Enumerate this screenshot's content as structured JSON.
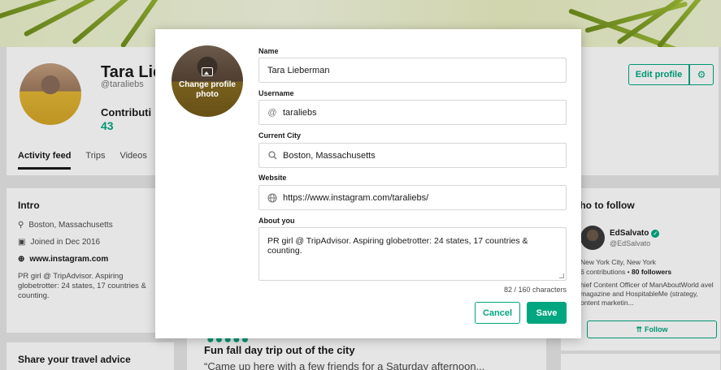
{
  "profile": {
    "name": "Tara Lieberman",
    "name_visible": "Tara Liel",
    "handle": "@taraliebs",
    "contributions_label": "Contributi",
    "contributions_count": "43"
  },
  "tabs": [
    "Activity feed",
    "Trips",
    "Videos"
  ],
  "header_actions": {
    "edit_label": "Edit profile",
    "settings_icon": "gear-icon"
  },
  "intro": {
    "title": "Intro",
    "location": "Boston, Massachusetts",
    "joined": "Joined in Dec 2016",
    "website": "www.instagram.com",
    "bio": "PR girl @ TripAdvisor. Aspiring globetrotter: 24 states, 17 countries & counting."
  },
  "share": {
    "title": "Share your travel advice"
  },
  "feed": {
    "rating": "●●●●●",
    "title": "Fun fall day trip out of the city",
    "quote": "“Came up here with a few friends for a Saturday afternoon..."
  },
  "who_to_follow": {
    "title": "Who to follow",
    "title_visible": "/ho to follow",
    "user": {
      "name": "EdSalvato",
      "handle": "@EdSalvato",
      "location": "New York City, New York",
      "contributions": "6 contributions",
      "followers": "80 followers",
      "bio": "hief Content Officer of ManAboutWorld avel magazine and HospitableMe (strategy, ontent marketin..."
    },
    "follow_label": "Follow"
  },
  "modal": {
    "avatar_label": "Change profile photo",
    "name_label": "Name",
    "name_value": "Tara Lieberman",
    "username_label": "Username",
    "username_prefix": "@",
    "username_value": "taraliebs",
    "city_label": "Current City",
    "city_value": "Boston, Massachusetts",
    "website_label": "Website",
    "website_value": "https://www.instagram.com/taraliebs/",
    "about_label": "About you",
    "about_value": "PR girl @ TripAdvisor. Aspiring globetrotter: 24 states, 17 countries & counting.",
    "counter": "82 / 160 characters",
    "cancel_label": "Cancel",
    "save_label": "Save"
  },
  "colors": {
    "accent": "#00a680",
    "text": "#1a1a1a",
    "muted": "#767676",
    "background": "#e6e6e6"
  }
}
